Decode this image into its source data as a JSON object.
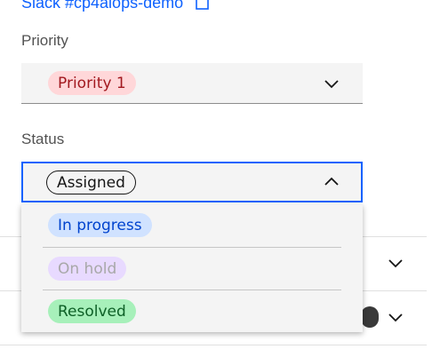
{
  "top_link": {
    "text": "Slack #cp4aiops-demo",
    "icon": "copy-icon"
  },
  "priority": {
    "label": "Priority",
    "selected": "Priority 1",
    "tag_color": "#ffd7d9",
    "icon": "chevron-down-icon"
  },
  "status": {
    "label": "Status",
    "selected": "Assigned",
    "expanded": true,
    "icon": "chevron-up-icon",
    "options": [
      {
        "label": "In progress",
        "color": "#d0e2ff"
      },
      {
        "label": "On hold",
        "color": "#e8daff",
        "disabled": true
      },
      {
        "label": "Resolved",
        "color": "#a7f0ba"
      }
    ]
  },
  "colors": {
    "focus": "#0f62fe",
    "link": "#0f62fe",
    "field_bg": "#f4f4f4"
  }
}
